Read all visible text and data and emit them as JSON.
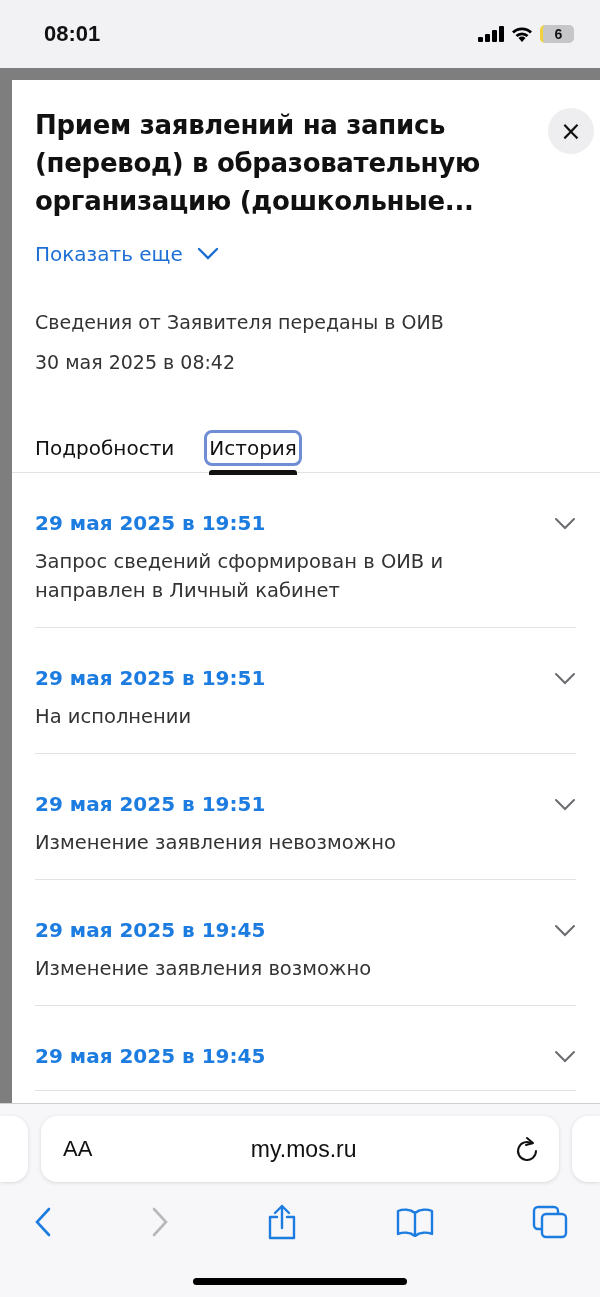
{
  "status_bar": {
    "time": "08:01",
    "battery": "6"
  },
  "sheet": {
    "close": "×",
    "title": "Прием заявлений на запись (перевод) в образовательную организацию (дошкольные...",
    "show_more": {
      "label": "Показать еще",
      "expanded": false
    },
    "status": "Сведения от Заявителя переданы в ОИВ",
    "status_date": "30 мая 2025 в 08:42",
    "tabs": [
      {
        "label": "Подробности",
        "selected": false
      },
      {
        "label": "История",
        "selected": true
      }
    ],
    "history": [
      {
        "date": "29 мая 2025 в 19:51",
        "text": "Запрос сведений сформирован в ОИВ и направлен в Личный кабинет",
        "expanded": false
      },
      {
        "date": "29 мая 2025 в 19:51",
        "text": "На исполнении",
        "expanded": false
      },
      {
        "date": "29 мая 2025 в 19:51",
        "text": "Изменение заявления невозможно",
        "expanded": false
      },
      {
        "date": "29 мая 2025 в 19:45",
        "text": "Изменение заявления возможно",
        "expanded": false
      },
      {
        "date": "29 мая 2025 в 19:45",
        "expanded": false
      }
    ]
  },
  "browser": {
    "text_size": "AA",
    "url": "my.mos.ru",
    "back_disabled": false,
    "forward_disabled": true
  }
}
